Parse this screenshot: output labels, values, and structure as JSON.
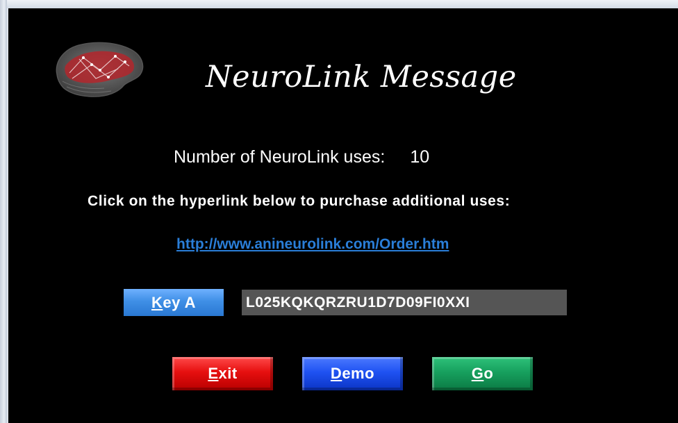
{
  "dialog": {
    "title": "NeuroLink Message",
    "logo_icon": "brain-icon",
    "uses_label": "Number of NeuroLink uses:",
    "uses_value": "10",
    "instruction": "Click on the hyperlink below to purchase additional uses:",
    "link_text": "http://www.anineurolink.com/Order.htm",
    "key": {
      "button_hotkey": "K",
      "button_rest": "ey A",
      "value": "L025KQKQRZRU1D7D09FI0XXI"
    },
    "buttons": {
      "exit": {
        "hotkey": "E",
        "rest": "xit",
        "color": "#e60f0f"
      },
      "demo": {
        "hotkey": "D",
        "rest": "emo",
        "color": "#1f52f2"
      },
      "go": {
        "hotkey": "G",
        "rest": "o",
        "color": "#17a05e"
      }
    },
    "colors": {
      "background": "#000000",
      "link": "#2a7ed8",
      "key_button": "#3f8fe6",
      "key_field": "#555555"
    }
  }
}
